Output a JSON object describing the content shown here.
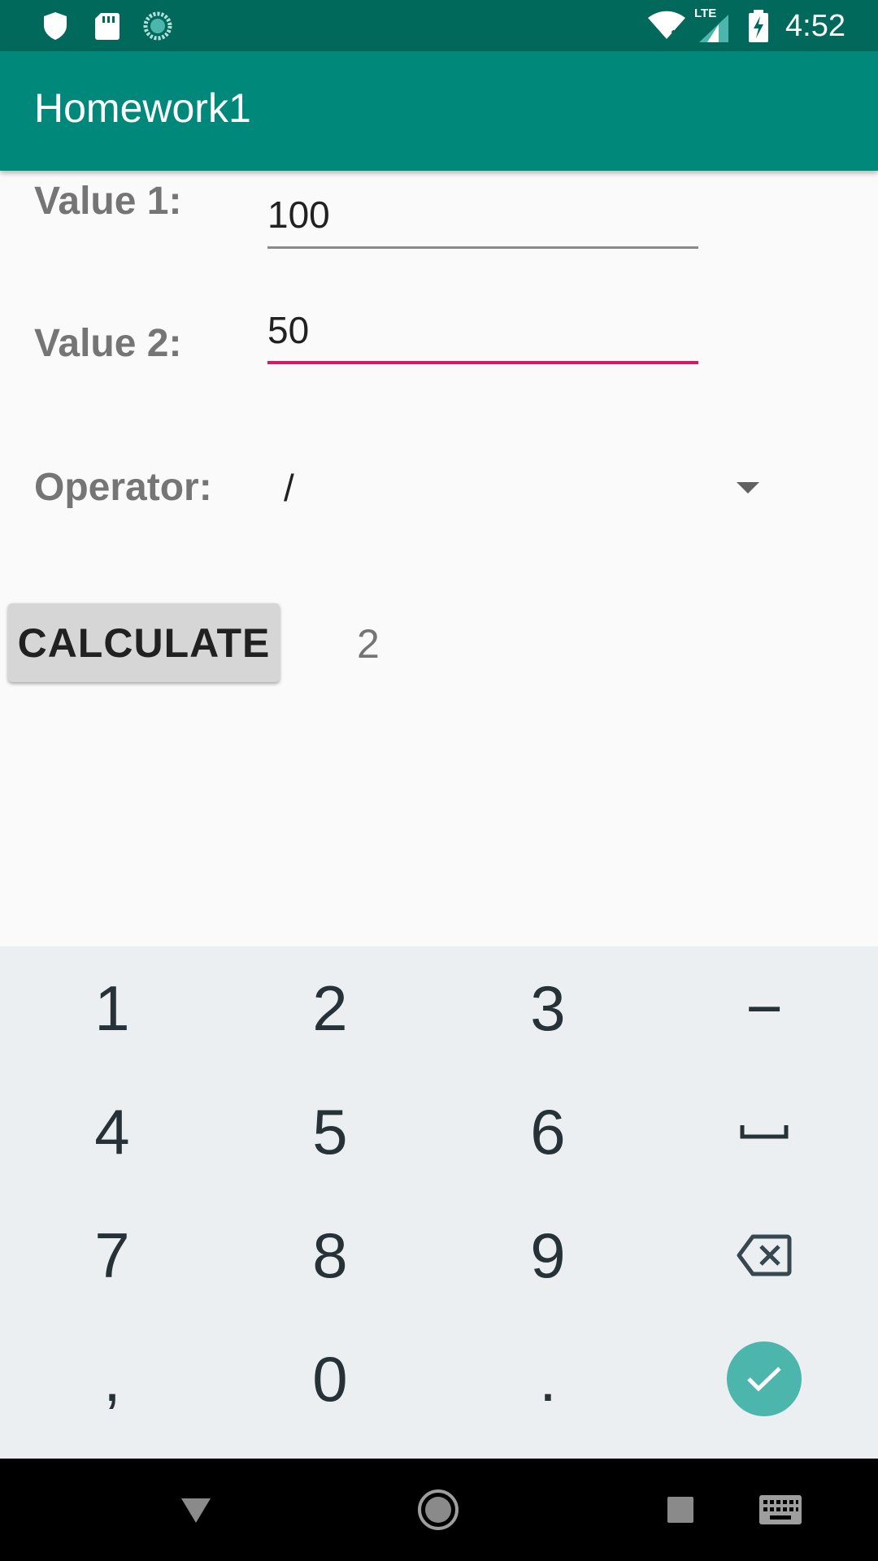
{
  "status_bar": {
    "time": "4:52",
    "icons": [
      "shield-icon",
      "sd-card-icon",
      "sync-icon",
      "wifi-icon",
      "lte-signal-icon",
      "battery-charging-icon"
    ]
  },
  "app_bar": {
    "title": "Homework1"
  },
  "form": {
    "value1": {
      "label": "Value 1:",
      "value": "100"
    },
    "value2": {
      "label": "Value 2:",
      "value": "50"
    },
    "operator": {
      "label": "Operator:",
      "selected": "/"
    },
    "calculate_label": "CALCULATE",
    "result": "2"
  },
  "colors": {
    "status_bar": "#00695c",
    "app_bar": "#00897b",
    "focus_underline": "#d81b60",
    "done_key": "#4db6ac"
  },
  "keyboard": {
    "rows": [
      [
        "1",
        "2",
        "3",
        "−"
      ],
      [
        "4",
        "5",
        "6",
        "space-icon"
      ],
      [
        "7",
        "8",
        "9",
        "backspace-icon"
      ],
      [
        ",",
        "0",
        ".",
        "done-icon"
      ]
    ]
  },
  "nav_bar": {
    "buttons": [
      "back-icon",
      "home-icon",
      "recents-icon",
      "keyboard-switch-icon"
    ]
  }
}
